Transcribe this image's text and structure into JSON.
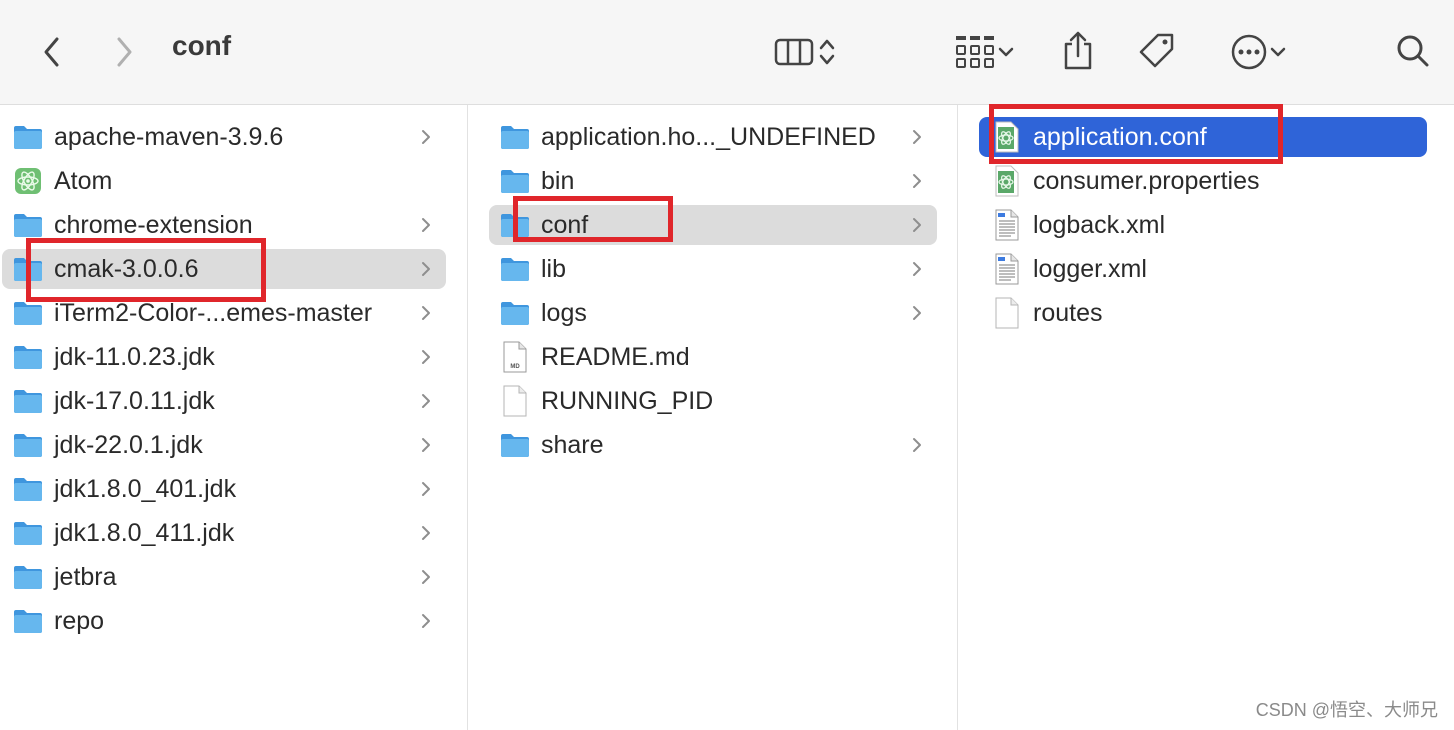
{
  "window": {
    "title": "conf",
    "toolbar": {
      "back_icon": "chevron-left-icon",
      "forward_icon": "chevron-right-icon",
      "view_icon": "column-view-icon",
      "group_icon": "grid-group-icon",
      "share_icon": "share-icon",
      "tag_icon": "tag-icon",
      "more_icon": "ellipsis-circle-icon",
      "search_icon": "search-icon"
    }
  },
  "column1": {
    "items": [
      {
        "label": "apache-maven-3.9.6",
        "icon": "folder-icon",
        "has_children": true
      },
      {
        "label": "Atom",
        "icon": "atom-app-icon",
        "has_children": false
      },
      {
        "label": "chrome-extension",
        "icon": "folder-icon",
        "has_children": true
      },
      {
        "label": "cmak-3.0.0.6",
        "icon": "folder-icon",
        "has_children": true,
        "selected": true
      },
      {
        "label": "iTerm2-Color-...emes-master",
        "icon": "folder-icon",
        "has_children": true
      },
      {
        "label": "jdk-11.0.23.jdk",
        "icon": "folder-icon",
        "has_children": true
      },
      {
        "label": "jdk-17.0.11.jdk",
        "icon": "folder-icon",
        "has_children": true
      },
      {
        "label": "jdk-22.0.1.jdk",
        "icon": "folder-icon",
        "has_children": true
      },
      {
        "label": "jdk1.8.0_401.jdk",
        "icon": "folder-icon",
        "has_children": true
      },
      {
        "label": "jdk1.8.0_411.jdk",
        "icon": "folder-icon",
        "has_children": true
      },
      {
        "label": "jetbra",
        "icon": "folder-icon",
        "has_children": true
      },
      {
        "label": "repo",
        "icon": "folder-icon",
        "has_children": true
      }
    ]
  },
  "column2": {
    "items": [
      {
        "label": "application.ho..._UNDEFINED",
        "icon": "folder-icon",
        "has_children": true
      },
      {
        "label": "bin",
        "icon": "folder-icon",
        "has_children": true
      },
      {
        "label": "conf",
        "icon": "folder-icon",
        "has_children": true,
        "selected": true
      },
      {
        "label": "lib",
        "icon": "folder-icon",
        "has_children": true
      },
      {
        "label": "logs",
        "icon": "folder-icon",
        "has_children": true
      },
      {
        "label": "README.md",
        "icon": "markdown-file-icon",
        "has_children": false
      },
      {
        "label": "RUNNING_PID",
        "icon": "blank-file-icon",
        "has_children": false
      },
      {
        "label": "share",
        "icon": "folder-icon",
        "has_children": true
      }
    ]
  },
  "column3": {
    "items": [
      {
        "label": "application.conf",
        "icon": "atom-file-icon",
        "selected": true
      },
      {
        "label": "consumer.properties",
        "icon": "atom-file-icon"
      },
      {
        "label": "logback.xml",
        "icon": "xml-file-icon"
      },
      {
        "label": "logger.xml",
        "icon": "xml-file-icon"
      },
      {
        "label": "routes",
        "icon": "blank-file-icon"
      }
    ]
  },
  "watermark": "CSDN @悟空、大师兄",
  "colors": {
    "selection_blue": "#2f64d8",
    "selection_gray": "#dcdcdc",
    "highlight_red": "#e0262b",
    "folder_blue": "#5aaee8"
  }
}
